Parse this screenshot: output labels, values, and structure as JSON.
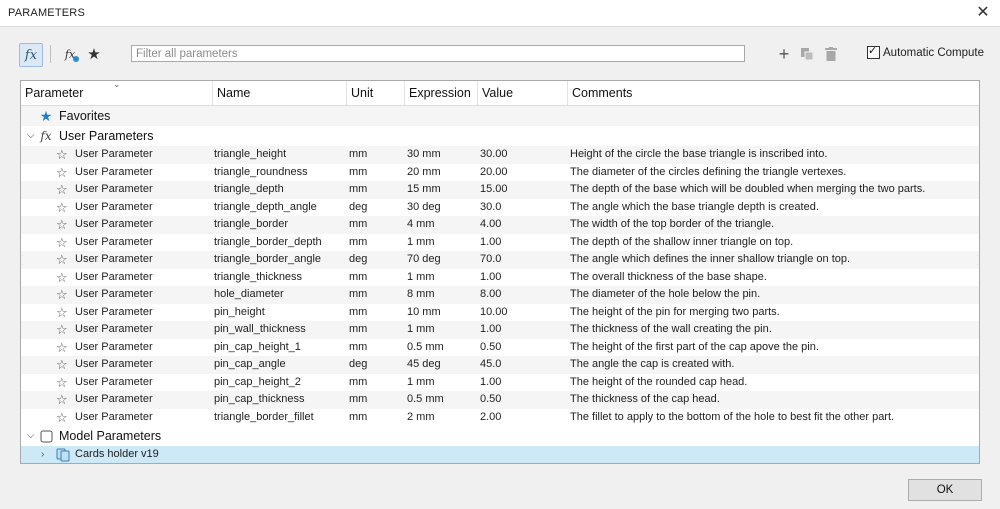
{
  "window": {
    "title": "PARAMETERS",
    "close": "✕"
  },
  "toolbar": {
    "fx_label": "fx",
    "search_placeholder": "Filter all parameters",
    "auto_compute_label": "Automatic Compute",
    "auto_compute_checked": true
  },
  "columns": [
    "Parameter",
    "Name",
    "Unit",
    "Expression",
    "Value",
    "Comments"
  ],
  "groups": {
    "favorites": "Favorites",
    "user": "User Parameters",
    "model": "Model Parameters"
  },
  "rows": [
    {
      "param": "User Parameter",
      "name": "triangle_height",
      "unit": "mm",
      "expr": "30 mm",
      "value": "30.00",
      "comment": "Height of the circle the base triangle is inscribed into."
    },
    {
      "param": "User Parameter",
      "name": "triangle_roundness",
      "unit": "mm",
      "expr": "20 mm",
      "value": "20.00",
      "comment": "The diameter of the circles defining the triangle vertexes."
    },
    {
      "param": "User Parameter",
      "name": "triangle_depth",
      "unit": "mm",
      "expr": "15 mm",
      "value": "15.00",
      "comment": "The depth of the base which will be doubled when merging the two parts."
    },
    {
      "param": "User Parameter",
      "name": "triangle_depth_angle",
      "unit": "deg",
      "expr": "30 deg",
      "value": "30.0",
      "comment": "The angle which the base triangle depth is created."
    },
    {
      "param": "User Parameter",
      "name": "triangle_border",
      "unit": "mm",
      "expr": "4 mm",
      "value": "4.00",
      "comment": "The width of the top border of the triangle."
    },
    {
      "param": "User Parameter",
      "name": "triangle_border_depth",
      "unit": "mm",
      "expr": "1 mm",
      "value": "1.00",
      "comment": "The depth of the shallow inner triangle on top."
    },
    {
      "param": "User Parameter",
      "name": "triangle_border_angle",
      "unit": "deg",
      "expr": "70 deg",
      "value": "70.0",
      "comment": "The angle which defines the inner shallow triangle on top."
    },
    {
      "param": "User Parameter",
      "name": "triangle_thickness",
      "unit": "mm",
      "expr": "1 mm",
      "value": "1.00",
      "comment": "The overall thickness of the base shape."
    },
    {
      "param": "User Parameter",
      "name": "hole_diameter",
      "unit": "mm",
      "expr": "8 mm",
      "value": "8.00",
      "comment": "The diameter of the hole below the pin."
    },
    {
      "param": "User Parameter",
      "name": "pin_height",
      "unit": "mm",
      "expr": "10 mm",
      "value": "10.00",
      "comment": "The height of the pin for merging two parts."
    },
    {
      "param": "User Parameter",
      "name": "pin_wall_thickness",
      "unit": "mm",
      "expr": "1 mm",
      "value": "1.00",
      "comment": "The thickness of the wall creating the pin."
    },
    {
      "param": "User Parameter",
      "name": "pin_cap_height_1",
      "unit": "mm",
      "expr": "0.5 mm",
      "value": "0.50",
      "comment": "The height of the first part of the cap apove the pin."
    },
    {
      "param": "User Parameter",
      "name": "pin_cap_angle",
      "unit": "deg",
      "expr": "45 deg",
      "value": "45.0",
      "comment": "The angle the cap is created with."
    },
    {
      "param": "User Parameter",
      "name": "pin_cap_height_2",
      "unit": "mm",
      "expr": "1 mm",
      "value": "1.00",
      "comment": "The height of the rounded cap head."
    },
    {
      "param": "User Parameter",
      "name": "pin_cap_thickness",
      "unit": "mm",
      "expr": "0.5 mm",
      "value": "0.50",
      "comment": "The thickness of the cap head."
    },
    {
      "param": "User Parameter",
      "name": "triangle_border_fillet",
      "unit": "mm",
      "expr": "2 mm",
      "value": "2.00",
      "comment": "The fillet to apply to the bottom of the hole to best fit the other part."
    }
  ],
  "model_item": "Cards holder v19",
  "ok_label": "OK",
  "colors": {
    "accent": "#1e7fd0",
    "selection": "#cde8f7"
  }
}
